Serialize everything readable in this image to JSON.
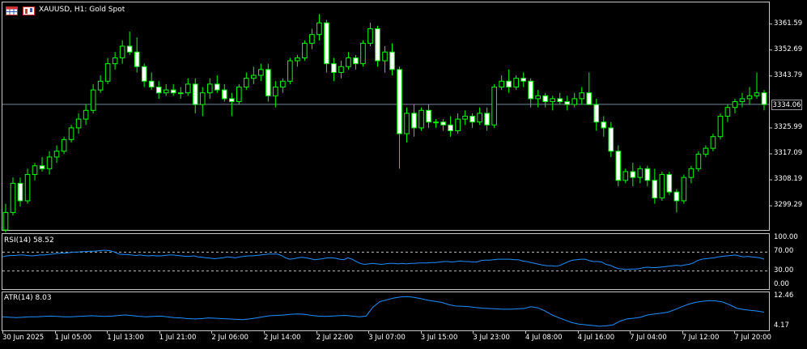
{
  "header": {
    "title": "XAUUSD, H1:  Gold Spot",
    "icons": [
      "candles-table-icon",
      "chart-type-icon"
    ]
  },
  "price_axis": {
    "ticks": [
      "3361.59",
      "3352.69",
      "3343.79",
      "3334.06",
      "3325.99",
      "3317.09",
      "3308.19",
      "3299.29"
    ],
    "current_price": "3334.06"
  },
  "rsi": {
    "title": "RSI(14) 58.52",
    "ticks": [
      "100.00",
      "70.00",
      "30.00",
      "0.00"
    ],
    "levels": [
      70,
      30
    ]
  },
  "atr": {
    "title": "ATR(14) 8.03",
    "ticks": [
      "12.46",
      "4.17"
    ]
  },
  "time_axis": {
    "labels": [
      "30 Jun 2025",
      "1 Jul 05:00",
      "1 Jul 13:00",
      "1 Jul 21:00",
      "2 Jul 06:00",
      "2 Jul 14:00",
      "2 Jul 22:00",
      "3 Jul 07:00",
      "3 Jul 15:00",
      "3 Jul 23:00",
      "4 Jul 08:00",
      "4 Jul 16:00",
      "7 Jul 04:00",
      "7 Jul 12:00",
      "7 Jul 20:00"
    ]
  },
  "colors": {
    "background": "#000000",
    "candle": "#00ff00",
    "bull_fill": "#000000",
    "bear_fill": "#ffffff",
    "indicator_line": "#1e90ff",
    "bid_line": "#778899",
    "grid_level": "#c0c0c0"
  },
  "chart_data": {
    "type": "candlestick",
    "symbol": "XAUUSD",
    "timeframe": "H1",
    "ylim": [
      3291.0,
      3369.0
    ],
    "candles": [
      [
        3291,
        3300,
        3289,
        3297
      ],
      [
        3297,
        3309,
        3296,
        3307
      ],
      [
        3307,
        3309,
        3299,
        3301
      ],
      [
        3301,
        3312,
        3300,
        3310
      ],
      [
        3310,
        3314,
        3308,
        3313
      ],
      [
        3313,
        3316,
        3311,
        3312
      ],
      [
        3312,
        3318,
        3310,
        3316
      ],
      [
        3316,
        3320,
        3314,
        3318
      ],
      [
        3318,
        3323,
        3317,
        3322
      ],
      [
        3322,
        3327,
        3321,
        3326
      ],
      [
        3326,
        3331,
        3324,
        3329
      ],
      [
        3329,
        3334,
        3327,
        3332
      ],
      [
        3332,
        3341,
        3331,
        3339
      ],
      [
        3339,
        3344,
        3338,
        3342
      ],
      [
        3342,
        3350,
        3341,
        3348
      ],
      [
        3348,
        3352,
        3346,
        3350
      ],
      [
        3350,
        3356,
        3348,
        3354
      ],
      [
        3354,
        3359,
        3351,
        3352
      ],
      [
        3352,
        3357,
        3345,
        3347
      ],
      [
        3347,
        3348,
        3340,
        3342
      ],
      [
        3342,
        3345,
        3339,
        3340
      ],
      [
        3340,
        3342,
        3336,
        3338
      ],
      [
        3338,
        3341,
        3337,
        3339
      ],
      [
        3339,
        3341,
        3337,
        3338
      ],
      [
        3338,
        3340,
        3336,
        3338
      ],
      [
        3338,
        3343,
        3337,
        3341
      ],
      [
        3341,
        3343,
        3331,
        3334
      ],
      [
        3334,
        3340,
        3330,
        3338
      ],
      [
        3338,
        3343,
        3336,
        3341
      ],
      [
        3341,
        3344,
        3338,
        3339
      ],
      [
        3339,
        3341,
        3335,
        3336
      ],
      [
        3336,
        3338,
        3330,
        3335
      ],
      [
        3335,
        3341,
        3334,
        3340
      ],
      [
        3340,
        3345,
        3339,
        3343
      ],
      [
        3343,
        3347,
        3341,
        3344
      ],
      [
        3344,
        3348,
        3342,
        3346
      ],
      [
        3346,
        3348,
        3335,
        3337
      ],
      [
        3337,
        3342,
        3333,
        3340
      ],
      [
        3340,
        3343,
        3338,
        3342
      ],
      [
        3342,
        3350,
        3341,
        3349
      ],
      [
        3349,
        3351,
        3347,
        3350
      ],
      [
        3350,
        3356,
        3349,
        3355
      ],
      [
        3355,
        3360,
        3353,
        3358
      ],
      [
        3358,
        3365,
        3356,
        3362
      ],
      [
        3362,
        3363,
        3345,
        3348
      ],
      [
        3348,
        3350,
        3342,
        3345
      ],
      [
        3345,
        3349,
        3343,
        3347
      ],
      [
        3347,
        3352,
        3346,
        3350
      ],
      [
        3350,
        3351,
        3346,
        3348
      ],
      [
        3348,
        3356,
        3347,
        3355
      ],
      [
        3355,
        3362,
        3354,
        3360
      ],
      [
        3360,
        3361,
        3347,
        3349
      ],
      [
        3349,
        3354,
        3345,
        3352
      ],
      [
        3352,
        3355,
        3344,
        3346
      ],
      [
        3346,
        3347,
        3312,
        3324
      ],
      [
        3324,
        3333,
        3321,
        3331
      ],
      [
        3331,
        3334,
        3323,
        3326
      ],
      [
        3326,
        3333,
        3325,
        3332
      ],
      [
        3332,
        3334,
        3326,
        3328
      ],
      [
        3328,
        3329,
        3326,
        3328
      ],
      [
        3328,
        3329,
        3325,
        3327
      ],
      [
        3327,
        3330,
        3323,
        3325
      ],
      [
        3325,
        3331,
        3324,
        3329
      ],
      [
        3329,
        3332,
        3327,
        3330
      ],
      [
        3330,
        3331,
        3326,
        3328
      ],
      [
        3328,
        3333,
        3327,
        3331
      ],
      [
        3331,
        3333,
        3325,
        3327
      ],
      [
        3327,
        3341,
        3326,
        3340
      ],
      [
        3340,
        3344,
        3339,
        3342
      ],
      [
        3342,
        3346,
        3338,
        3340
      ],
      [
        3340,
        3344,
        3339,
        3343
      ],
      [
        3343,
        3345,
        3340,
        3342
      ],
      [
        3342,
        3343,
        3333,
        3336
      ],
      [
        3336,
        3339,
        3333,
        3337
      ],
      [
        3337,
        3338,
        3333,
        3335
      ],
      [
        3335,
        3337,
        3332,
        3336
      ],
      [
        3336,
        3338,
        3334,
        3335
      ],
      [
        3335,
        3337,
        3332,
        3334
      ],
      [
        3334,
        3338,
        3333,
        3336
      ],
      [
        3336,
        3340,
        3334,
        3338
      ],
      [
        3338,
        3345,
        3334,
        3334
      ],
      [
        3334,
        3336,
        3325,
        3328
      ],
      [
        3328,
        3330,
        3323,
        3326
      ],
      [
        3326,
        3328,
        3316,
        3318
      ],
      [
        3318,
        3320,
        3306,
        3308
      ],
      [
        3308,
        3312,
        3307,
        3311
      ],
      [
        3311,
        3314,
        3306,
        3309
      ],
      [
        3309,
        3313,
        3307,
        3312
      ],
      [
        3312,
        3313,
        3306,
        3308
      ],
      [
        3308,
        3312,
        3300,
        3302
      ],
      [
        3302,
        3311,
        3301,
        3310
      ],
      [
        3310,
        3311,
        3303,
        3304
      ],
      [
        3304,
        3305,
        3297,
        3301
      ],
      [
        3301,
        3310,
        3300,
        3309
      ],
      [
        3309,
        3313,
        3307,
        3312
      ],
      [
        3312,
        3318,
        3311,
        3317
      ],
      [
        3317,
        3320,
        3316,
        3319
      ],
      [
        3319,
        3324,
        3318,
        3323
      ],
      [
        3323,
        3331,
        3322,
        3330
      ],
      [
        3330,
        3334,
        3328,
        3333
      ],
      [
        3333,
        3336,
        3331,
        3335
      ],
      [
        3335,
        3338,
        3333,
        3336
      ],
      [
        3336,
        3340,
        3334,
        3337
      ],
      [
        3337,
        3345,
        3336,
        3338
      ],
      [
        3338,
        3339,
        3332,
        3334
      ]
    ],
    "rsi_values": [
      60,
      62,
      63,
      63,
      64,
      64,
      63,
      62,
      63,
      64,
      64,
      65,
      66,
      67,
      68,
      68,
      69,
      70,
      70,
      71,
      71,
      72,
      72,
      73,
      74,
      74,
      73,
      70,
      66,
      65,
      65,
      64,
      63,
      64,
      63,
      62,
      63,
      62,
      62,
      63,
      64,
      64,
      63,
      62,
      61,
      61,
      62,
      60,
      59,
      58,
      57,
      56,
      57,
      58,
      60,
      59,
      58,
      60,
      61,
      62,
      62,
      63,
      64,
      65,
      66,
      66,
      66,
      63,
      58,
      55,
      56,
      58,
      59,
      58,
      56,
      54,
      55,
      56,
      58,
      58,
      57,
      55,
      54,
      58,
      55,
      50,
      46,
      44,
      45,
      46,
      45,
      44,
      45,
      46,
      46,
      45,
      46,
      45,
      46,
      46,
      47,
      47,
      47,
      48,
      48,
      49,
      50,
      50,
      49,
      50,
      51,
      50,
      50,
      49,
      49,
      52,
      53,
      53,
      54,
      55,
      55,
      55,
      55,
      54,
      54,
      51,
      50,
      48,
      46,
      44,
      42,
      41,
      41,
      40,
      42,
      46,
      50,
      53,
      54,
      55,
      55,
      52,
      50,
      50,
      49,
      44,
      42,
      38,
      35,
      34,
      33,
      34,
      34,
      35,
      37,
      38,
      37,
      37,
      38,
      39,
      40,
      41,
      42,
      41,
      43,
      44,
      47,
      52,
      55,
      56,
      57,
      58,
      60,
      61,
      62,
      63,
      64,
      62,
      60,
      61,
      60,
      59,
      58,
      55
    ],
    "atr_values": [
      6.8,
      6.7,
      6.6,
      6.7,
      6.8,
      6.8,
      6.9,
      7.0,
      6.9,
      6.8,
      6.8,
      6.9,
      7.0,
      7.1,
      7.0,
      6.9,
      7.0,
      7.2,
      7.3,
      7.1,
      6.9,
      6.8,
      6.9,
      7.0,
      6.8,
      6.6,
      6.5,
      6.3,
      6.2,
      6.3,
      6.5,
      6.4,
      6.3,
      6.2,
      6.1,
      6.0,
      6.2,
      6.5,
      6.8,
      7.1,
      7.2,
      7.3,
      7.5,
      7.6,
      7.5,
      7.2,
      7.0,
      6.9,
      7.0,
      7.1,
      7.2,
      7.0,
      6.8,
      7.0,
      9.5,
      11.0,
      11.5,
      12.0,
      12.3,
      12.4,
      12.2,
      11.8,
      11.4,
      11.1,
      10.8,
      10.2,
      9.8,
      9.7,
      9.6,
      9.4,
      9.2,
      9.1,
      9.0,
      8.9,
      8.9,
      9.0,
      9.1,
      9.6,
      9.3,
      8.5,
      7.4,
      6.6,
      5.9,
      5.2,
      4.8,
      4.6,
      4.4,
      4.2,
      4.3,
      4.6,
      5.6,
      6.2,
      6.4,
      6.7,
      7.3,
      7.6,
      7.8,
      8.1,
      8.8,
      9.6,
      10.3,
      10.8,
      11.1,
      11.3,
      11.2,
      10.9,
      10.1,
      9.2,
      8.8,
      8.6,
      8.4,
      8.1
    ]
  }
}
